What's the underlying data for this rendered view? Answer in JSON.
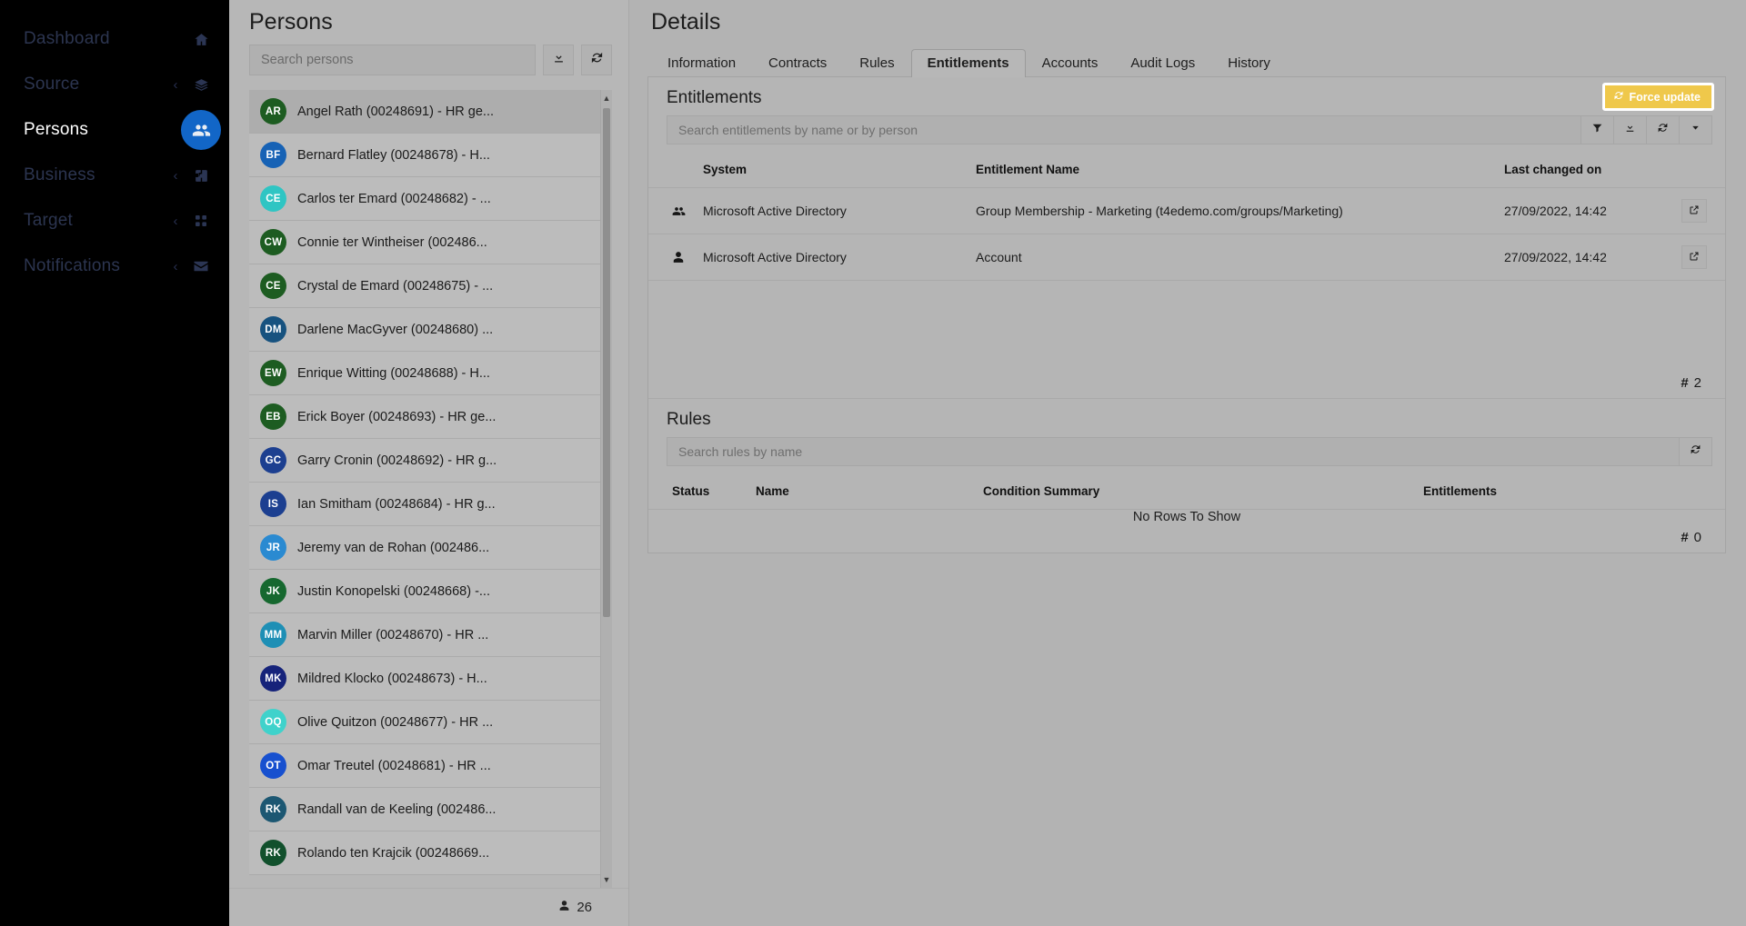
{
  "sidebar": {
    "items": [
      {
        "label": "Dashboard",
        "icon": "home-icon",
        "expandable": false,
        "active": false
      },
      {
        "label": "Source",
        "icon": "layers-icon",
        "expandable": true,
        "active": false
      },
      {
        "label": "Persons",
        "icon": "people-icon",
        "expandable": false,
        "active": true
      },
      {
        "label": "Business",
        "icon": "puzzle-icon",
        "expandable": true,
        "active": false
      },
      {
        "label": "Target",
        "icon": "grid-icon",
        "expandable": true,
        "active": false
      },
      {
        "label": "Notifications",
        "icon": "envelope-icon",
        "expandable": true,
        "active": false
      }
    ],
    "chevron_glyph": "‹"
  },
  "persons": {
    "title": "Persons",
    "search_placeholder": "Search persons",
    "download_icon": "download-icon",
    "refresh_icon": "refresh-icon",
    "footer_count": "26",
    "footer_icon": "person-icon",
    "scroll_up_glyph": "▲",
    "scroll_down_glyph": "▼",
    "list": [
      {
        "initials": "AR",
        "name": "Angel Rath (00248691) - HR ge...",
        "color": "#1d5c21",
        "selected": true
      },
      {
        "initials": "BF",
        "name": "Bernard Flatley (00248678) - H...",
        "color": "#1762b5",
        "selected": false
      },
      {
        "initials": "CE",
        "name": "Carlos ter Emard (00248682) - ...",
        "color": "#2fc5c3",
        "selected": false
      },
      {
        "initials": "CW",
        "name": "Connie ter Wintheiser (002486...",
        "color": "#1d5c21",
        "selected": false
      },
      {
        "initials": "CE",
        "name": "Crystal de Emard (00248675) - ...",
        "color": "#1d5c21",
        "selected": false
      },
      {
        "initials": "DM",
        "name": "Darlene MacGyver (00248680) ...",
        "color": "#17527f",
        "selected": false
      },
      {
        "initials": "EW",
        "name": "Enrique Witting (00248688) - H...",
        "color": "#1d5c21",
        "selected": false
      },
      {
        "initials": "EB",
        "name": "Erick Boyer (00248693) - HR ge...",
        "color": "#1d5c21",
        "selected": false
      },
      {
        "initials": "GC",
        "name": "Garry Cronin (00248692) - HR g...",
        "color": "#1c3f90",
        "selected": false
      },
      {
        "initials": "IS",
        "name": "Ian Smitham (00248684) - HR g...",
        "color": "#1c3f90",
        "selected": false
      },
      {
        "initials": "JR",
        "name": "Jeremy van de Rohan (002486...",
        "color": "#2a8ad1",
        "selected": false
      },
      {
        "initials": "JK",
        "name": "Justin Konopelski (00248668) -...",
        "color": "#16682f",
        "selected": false
      },
      {
        "initials": "MM",
        "name": "Marvin Miller (00248670) - HR ...",
        "color": "#1e8fb5",
        "selected": false
      },
      {
        "initials": "MK",
        "name": "Mildred Klocko (00248673) - H...",
        "color": "#16237a",
        "selected": false
      },
      {
        "initials": "OQ",
        "name": "Olive Quitzon (00248677) - HR ...",
        "color": "#3fd2cb",
        "selected": false
      },
      {
        "initials": "OT",
        "name": "Omar Treutel (00248681) - HR ...",
        "color": "#1750cf",
        "selected": false
      },
      {
        "initials": "RK",
        "name": "Randall van de Keeling (002486...",
        "color": "#1c5772",
        "selected": false
      },
      {
        "initials": "RK",
        "name": "Rolando ten Krajcik (00248669...",
        "color": "#11502c",
        "selected": false
      }
    ]
  },
  "details": {
    "title": "Details",
    "tabs": [
      {
        "label": "Information",
        "active": false
      },
      {
        "label": "Contracts",
        "active": false
      },
      {
        "label": "Rules",
        "active": false
      },
      {
        "label": "Entitlements",
        "active": true
      },
      {
        "label": "Accounts",
        "active": false
      },
      {
        "label": "Audit Logs",
        "active": false
      },
      {
        "label": "History",
        "active": false
      }
    ],
    "entitlements": {
      "title": "Entitlements",
      "force_update_label": "Force update",
      "force_update_icon": "refresh-icon",
      "search_placeholder": "Search entitlements by name or by person",
      "toolbar_icons": [
        "filter-icon",
        "download-icon",
        "refresh-icon",
        "chevron-down-icon"
      ],
      "columns": [
        "",
        "System",
        "Entitlement Name",
        "Last changed on",
        ""
      ],
      "rows": [
        {
          "icon": "group-icon",
          "system": "Microsoft Active Directory",
          "name": "Group Membership - Marketing (t4edemo.com/groups/Marketing)",
          "last_changed": "27/09/2022, 14:42",
          "action_icon": "open-external-icon"
        },
        {
          "icon": "person-icon",
          "system": "Microsoft Active Directory",
          "name": "Account",
          "last_changed": "27/09/2022, 14:42",
          "action_icon": "open-external-icon"
        }
      ],
      "count_hash": "#",
      "count_value": "2"
    },
    "rules": {
      "title": "Rules",
      "search_placeholder": "Search rules by name",
      "refresh_icon": "refresh-icon",
      "columns": [
        "Status",
        "Name",
        "Condition Summary",
        "Entitlements"
      ],
      "empty_message": "No Rows To Show",
      "count_hash": "#",
      "count_value": "0"
    }
  },
  "colors": {
    "accent": "#1266c7",
    "warning": "#efc84b",
    "sidebar_bg": "#000000",
    "panel_bg": "#b3b3b3"
  }
}
